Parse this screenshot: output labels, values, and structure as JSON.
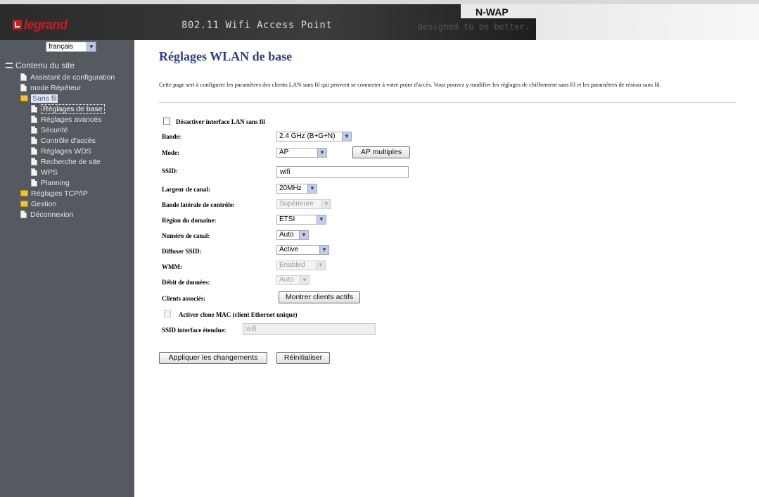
{
  "header": {
    "logo_text": "legrand",
    "app_title": "802.11 Wifi Access Point",
    "product": "N-WAP",
    "tagline": "designed to be better."
  },
  "sidebar": {
    "language": "français",
    "root": "Contenu du site",
    "items": [
      {
        "label": "Assistant de configuration"
      },
      {
        "label": "mode Répéteur"
      },
      {
        "label": "Sans fil"
      },
      {
        "label": "Réglages de base"
      },
      {
        "label": "Réglages avancés"
      },
      {
        "label": "Sécurité"
      },
      {
        "label": "Contrôle d'accès"
      },
      {
        "label": "Réglages WDS"
      },
      {
        "label": "Recherche de site"
      },
      {
        "label": "WPS"
      },
      {
        "label": "Planning"
      },
      {
        "label": "Réglages TCP/IP"
      },
      {
        "label": "Gestion"
      },
      {
        "label": "Déconnexion"
      }
    ]
  },
  "main": {
    "title": "Réglages WLAN de base",
    "description": "Cette page sert à configurer les paramètres des clients LAN sans fil qui peuvent se connecter à votre point d'accès. Vous pouvez y modifier les réglages de chiffrement sans fil et les paramètres de réseau sans fil.",
    "disable_wlan_label": "Désactiver interface LAN sans fil",
    "fields": {
      "band": {
        "label": "Bande:",
        "value": "2.4 GHz (B+G+N)"
      },
      "mode": {
        "label": "Mode:",
        "value": "AP"
      },
      "multi_ap_button": "AP multiples",
      "ssid": {
        "label": "SSID:",
        "value": "wifi"
      },
      "channel_width": {
        "label": "Largeur de canal:",
        "value": "20MHz"
      },
      "control_sideband": {
        "label": "Bande latérale de contrôle:",
        "value": "Supérieure"
      },
      "domain_region": {
        "label": "Région du domaine:",
        "value": "ETSI"
      },
      "channel_number": {
        "label": "Numéro de canal:",
        "value": "Auto"
      },
      "broadcast_ssid": {
        "label": "Diffuser SSID:",
        "value": "Active"
      },
      "wmm": {
        "label": "WMM:",
        "value": "Enabled"
      },
      "data_rate": {
        "label": "Débit de données:",
        "value": "Auto"
      },
      "associated_clients": {
        "label": "Clients associés:",
        "button": "Montrer clients actifs"
      },
      "mac_clone_label": "Activer clone MAC (client Ethernet unique)",
      "extended_ssid": {
        "label": "SSID interface étendue:",
        "value": "wifi"
      }
    },
    "apply_button": "Appliquer les changements",
    "reset_button": "Réinitialiser"
  }
}
